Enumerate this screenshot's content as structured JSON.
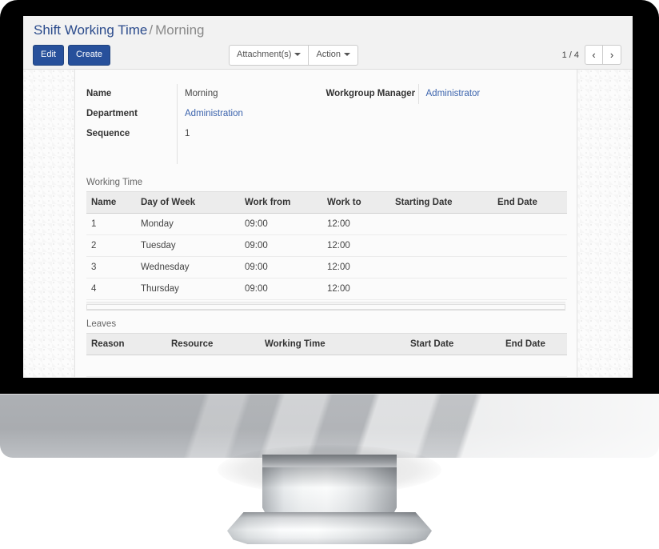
{
  "window": {
    "device": "desktop-monitor"
  },
  "breadcrumb": {
    "root_label": "Shift Working Time",
    "separator": "/",
    "current_label": "Morning"
  },
  "toolbar": {
    "edit_label": "Edit",
    "create_label": "Create",
    "attachments_label": "Attachment(s)",
    "action_label": "Action",
    "pager_count": "1 / 4",
    "prev_glyph": "‹",
    "next_glyph": "›"
  },
  "form": {
    "left": [
      {
        "label": "Name",
        "value": "Morning",
        "is_link": false
      },
      {
        "label": "Department",
        "value": "Administration",
        "is_link": true
      },
      {
        "label": "Sequence",
        "value": "1",
        "is_link": false
      }
    ],
    "right": [
      {
        "label": "Workgroup Manager",
        "value": "Administrator",
        "is_link": true
      }
    ]
  },
  "working_time": {
    "title": "Working Time",
    "columns": [
      "Name",
      "Day of Week",
      "Work from",
      "Work to",
      "Starting Date",
      "End Date"
    ],
    "rows": [
      {
        "name": "1",
        "day_of_week": "Monday",
        "work_from": "09:00",
        "work_to": "12:00",
        "starting_date": "",
        "end_date": ""
      },
      {
        "name": "2",
        "day_of_week": "Tuesday",
        "work_from": "09:00",
        "work_to": "12:00",
        "starting_date": "",
        "end_date": ""
      },
      {
        "name": "3",
        "day_of_week": "Wednesday",
        "work_from": "09:00",
        "work_to": "12:00",
        "starting_date": "",
        "end_date": ""
      },
      {
        "name": "4",
        "day_of_week": "Thursday",
        "work_from": "09:00",
        "work_to": "12:00",
        "starting_date": "",
        "end_date": ""
      }
    ]
  },
  "leaves": {
    "title": "Leaves",
    "columns": [
      "Reason",
      "Resource",
      "Working Time",
      "Start Date",
      "End Date"
    ],
    "rows": []
  },
  "colors": {
    "primary_button": "#27509b",
    "link": "#2b4b8c",
    "table_header_bg": "#ececec",
    "bezel": "#000000"
  }
}
